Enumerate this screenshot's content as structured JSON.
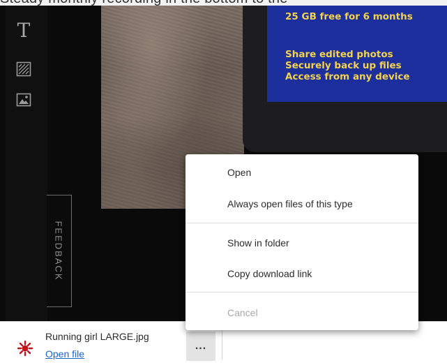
{
  "top_banner": {
    "text": "Steady monthly recording in the bottom to the"
  },
  "promo": {
    "headline": "25 GB free for 6 months",
    "features": [
      "Share edited photos",
      "Securely back up files",
      "Access from any device"
    ]
  },
  "feedback_tab": {
    "label": "FEEDBACK"
  },
  "download": {
    "file_name": "Running girl LARGE.jpg",
    "open_label": "Open file",
    "more_label": "..."
  },
  "context_menu": {
    "items": [
      {
        "label": "Open",
        "enabled": true
      },
      {
        "label": "Always open files of this type",
        "enabled": true
      },
      {
        "label": "Show in folder",
        "enabled": true
      },
      {
        "label": "Copy download link",
        "enabled": true
      },
      {
        "label": "Cancel",
        "enabled": false
      }
    ]
  },
  "colors": {
    "promo_background": "#1c2f9c",
    "promo_text": "#f3d24e",
    "link": "#1a62c8",
    "file_icon": "#c0141e"
  },
  "icons": [
    "text-tool-icon",
    "texture-tool-icon",
    "image-tool-icon",
    "image-file-icon"
  ]
}
